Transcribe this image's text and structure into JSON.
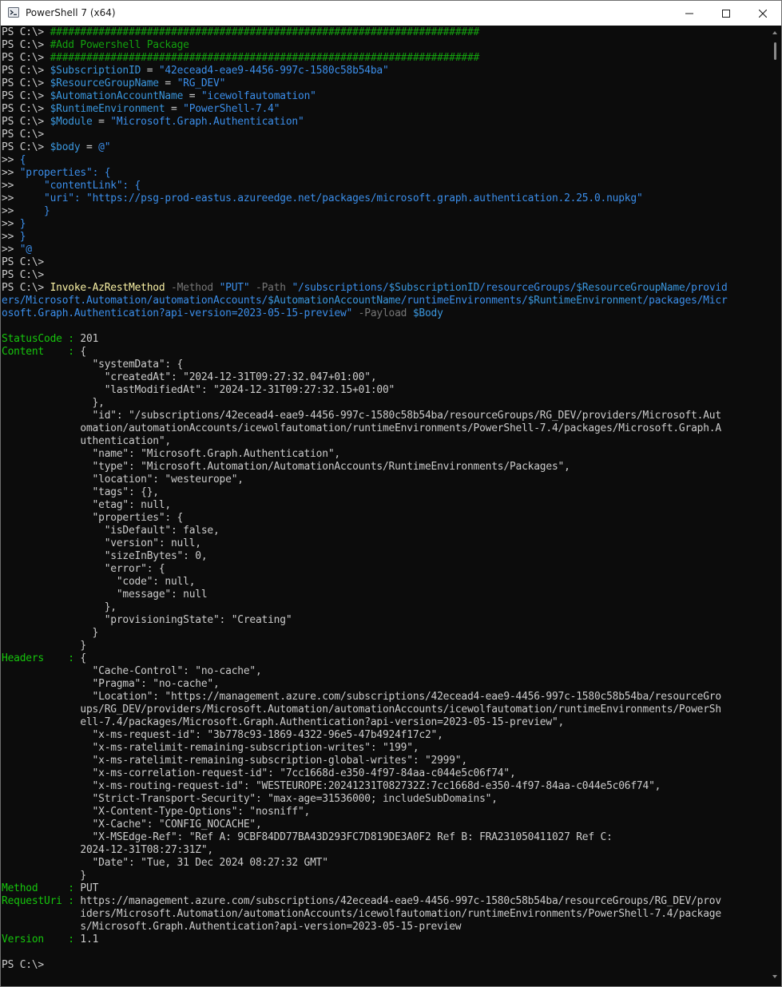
{
  "window": {
    "title": "PowerShell 7 (x64)",
    "icon": "powershell-icon",
    "controls": {
      "minimize": "minimize-icon",
      "maximize": "maximize-icon",
      "close": "close-icon"
    }
  },
  "colors": {
    "background": "#0c0c0c",
    "default_text": "#cccccc",
    "comment": "#13a10e",
    "variable": "#3a96dd",
    "string": "#3b8eea",
    "command": "#f9f1a5",
    "parameter": "#767676",
    "property_name": "#16c60c"
  },
  "terminal": {
    "lines": [
      [
        {
          "t": "PS C:\\> ",
          "c": "default"
        },
        {
          "t": "#######################################################################",
          "c": "comment"
        }
      ],
      [
        {
          "t": "PS C:\\> ",
          "c": "default"
        },
        {
          "t": "#Add Powershell Package",
          "c": "comment"
        }
      ],
      [
        {
          "t": "PS C:\\> ",
          "c": "default"
        },
        {
          "t": "#######################################################################",
          "c": "comment"
        }
      ],
      [
        {
          "t": "PS C:\\> ",
          "c": "default"
        },
        {
          "t": "$SubscriptionID",
          "c": "var"
        },
        {
          "t": " = ",
          "c": "op"
        },
        {
          "t": "\"42ecead4-eae9-4456-997c-1580c58b54ba\"",
          "c": "string"
        }
      ],
      [
        {
          "t": "PS C:\\> ",
          "c": "default"
        },
        {
          "t": "$ResourceGroupName",
          "c": "var"
        },
        {
          "t": " = ",
          "c": "op"
        },
        {
          "t": "\"RG_DEV\"",
          "c": "string"
        }
      ],
      [
        {
          "t": "PS C:\\> ",
          "c": "default"
        },
        {
          "t": "$AutomationAccountName",
          "c": "var"
        },
        {
          "t": " = ",
          "c": "op"
        },
        {
          "t": "\"icewolfautomation\"",
          "c": "string"
        }
      ],
      [
        {
          "t": "PS C:\\> ",
          "c": "default"
        },
        {
          "t": "$RuntimeEnvironment",
          "c": "var"
        },
        {
          "t": " = ",
          "c": "op"
        },
        {
          "t": "\"PowerShell-7.4\"",
          "c": "string"
        }
      ],
      [
        {
          "t": "PS C:\\> ",
          "c": "default"
        },
        {
          "t": "$Module",
          "c": "var"
        },
        {
          "t": " = ",
          "c": "op"
        },
        {
          "t": "\"Microsoft.Graph.Authentication\"",
          "c": "string"
        }
      ],
      [
        {
          "t": "PS C:\\>",
          "c": "default"
        }
      ],
      [
        {
          "t": "PS C:\\> ",
          "c": "default"
        },
        {
          "t": "$body",
          "c": "var"
        },
        {
          "t": " = ",
          "c": "op"
        },
        {
          "t": "@\"",
          "c": "string"
        }
      ],
      [
        {
          "t": ">> ",
          "c": "default"
        },
        {
          "t": "{",
          "c": "brace"
        }
      ],
      [
        {
          "t": ">> ",
          "c": "default"
        },
        {
          "t": "\"properties\": {",
          "c": "brace"
        }
      ],
      [
        {
          "t": ">>     ",
          "c": "default"
        },
        {
          "t": "\"contentLink\": {",
          "c": "brace"
        }
      ],
      [
        {
          "t": ">>     ",
          "c": "default"
        },
        {
          "t": "\"uri\": \"https://psg-prod-eastus.azureedge.net/packages/microsoft.graph.authentication.2.25.0.nupkg\"",
          "c": "brace"
        }
      ],
      [
        {
          "t": ">>     ",
          "c": "default"
        },
        {
          "t": "}",
          "c": "brace"
        }
      ],
      [
        {
          "t": ">> ",
          "c": "default"
        },
        {
          "t": "}",
          "c": "brace"
        }
      ],
      [
        {
          "t": ">> ",
          "c": "default"
        },
        {
          "t": "}",
          "c": "brace"
        }
      ],
      [
        {
          "t": ">> ",
          "c": "default"
        },
        {
          "t": "\"@",
          "c": "brace"
        }
      ],
      [
        {
          "t": "PS C:\\>",
          "c": "default"
        }
      ],
      [
        {
          "t": "PS C:\\>",
          "c": "default"
        }
      ],
      [
        {
          "t": "PS C:\\> ",
          "c": "default"
        },
        {
          "t": "Invoke-AzRestMethod",
          "c": "cmd"
        },
        {
          "t": " -Method ",
          "c": "param"
        },
        {
          "t": "\"PUT\"",
          "c": "string"
        },
        {
          "t": " -Path ",
          "c": "param"
        },
        {
          "t": "\"/subscriptions/",
          "c": "string"
        },
        {
          "t": "$SubscriptionID",
          "c": "var"
        },
        {
          "t": "/resourceGroups/",
          "c": "string"
        },
        {
          "t": "$ResourceGroupName",
          "c": "var"
        },
        {
          "t": "/provid",
          "c": "string"
        }
      ],
      [
        {
          "t": "ers/Microsoft.Automation/automationAccounts/",
          "c": "string"
        },
        {
          "t": "$AutomationAccountName",
          "c": "var"
        },
        {
          "t": "/runtimeEnvironments/",
          "c": "string"
        },
        {
          "t": "$RuntimeEnvironment",
          "c": "var"
        },
        {
          "t": "/packages/Micr",
          "c": "string"
        }
      ],
      [
        {
          "t": "osoft.Graph.Authentication?api-version=2023-05-15-preview\"",
          "c": "string"
        },
        {
          "t": " -Payload ",
          "c": "param"
        },
        {
          "t": "$Body",
          "c": "var"
        }
      ],
      [
        {
          "t": "",
          "c": "default"
        }
      ],
      [
        {
          "t": "StatusCode : ",
          "c": "key"
        },
        {
          "t": "201",
          "c": "default"
        }
      ],
      [
        {
          "t": "Content    : ",
          "c": "key"
        },
        {
          "t": "{",
          "c": "default"
        }
      ],
      [
        {
          "t": "               \"systemData\": {",
          "c": "default"
        }
      ],
      [
        {
          "t": "                 \"createdAt\": \"2024-12-31T09:27:32.047+01:00\",",
          "c": "default"
        }
      ],
      [
        {
          "t": "                 \"lastModifiedAt\": \"2024-12-31T09:27:32.15+01:00\"",
          "c": "default"
        }
      ],
      [
        {
          "t": "               },",
          "c": "default"
        }
      ],
      [
        {
          "t": "               \"id\": \"/subscriptions/42ecead4-eae9-4456-997c-1580c58b54ba/resourceGroups/RG_DEV/providers/Microsoft.Aut",
          "c": "default"
        }
      ],
      [
        {
          "t": "             omation/automationAccounts/icewolfautomation/runtimeEnvironments/PowerShell-7.4/packages/Microsoft.Graph.A",
          "c": "default"
        }
      ],
      [
        {
          "t": "             uthentication\",",
          "c": "default"
        }
      ],
      [
        {
          "t": "               \"name\": \"Microsoft.Graph.Authentication\",",
          "c": "default"
        }
      ],
      [
        {
          "t": "               \"type\": \"Microsoft.Automation/AutomationAccounts/RuntimeEnvironments/Packages\",",
          "c": "default"
        }
      ],
      [
        {
          "t": "               \"location\": \"westeurope\",",
          "c": "default"
        }
      ],
      [
        {
          "t": "               \"tags\": {},",
          "c": "default"
        }
      ],
      [
        {
          "t": "               \"etag\": null,",
          "c": "default"
        }
      ],
      [
        {
          "t": "               \"properties\": {",
          "c": "default"
        }
      ],
      [
        {
          "t": "                 \"isDefault\": false,",
          "c": "default"
        }
      ],
      [
        {
          "t": "                 \"version\": null,",
          "c": "default"
        }
      ],
      [
        {
          "t": "                 \"sizeInBytes\": 0,",
          "c": "default"
        }
      ],
      [
        {
          "t": "                 \"error\": {",
          "c": "default"
        }
      ],
      [
        {
          "t": "                   \"code\": null,",
          "c": "default"
        }
      ],
      [
        {
          "t": "                   \"message\": null",
          "c": "default"
        }
      ],
      [
        {
          "t": "                 },",
          "c": "default"
        }
      ],
      [
        {
          "t": "                 \"provisioningState\": \"Creating\"",
          "c": "default"
        }
      ],
      [
        {
          "t": "               }",
          "c": "default"
        }
      ],
      [
        {
          "t": "             }",
          "c": "default"
        }
      ],
      [
        {
          "t": "Headers    : ",
          "c": "key"
        },
        {
          "t": "{",
          "c": "default"
        }
      ],
      [
        {
          "t": "               \"Cache-Control\": \"no-cache\",",
          "c": "default"
        }
      ],
      [
        {
          "t": "               \"Pragma\": \"no-cache\",",
          "c": "default"
        }
      ],
      [
        {
          "t": "               \"Location\": \"https://management.azure.com/subscriptions/42ecead4-eae9-4456-997c-1580c58b54ba/resourceGro",
          "c": "default"
        }
      ],
      [
        {
          "t": "             ups/RG_DEV/providers/Microsoft.Automation/automationAccounts/icewolfautomation/runtimeEnvironments/PowerSh",
          "c": "default"
        }
      ],
      [
        {
          "t": "             ell-7.4/packages/Microsoft.Graph.Authentication?api-version=2023-05-15-preview\",",
          "c": "default"
        }
      ],
      [
        {
          "t": "               \"x-ms-request-id\": \"3b778c93-1869-4322-96e5-47b4924f17c2\",",
          "c": "default"
        }
      ],
      [
        {
          "t": "               \"x-ms-ratelimit-remaining-subscription-writes\": \"199\",",
          "c": "default"
        }
      ],
      [
        {
          "t": "               \"x-ms-ratelimit-remaining-subscription-global-writes\": \"2999\",",
          "c": "default"
        }
      ],
      [
        {
          "t": "               \"x-ms-correlation-request-id\": \"7cc1668d-e350-4f97-84aa-c044e5c06f74\",",
          "c": "default"
        }
      ],
      [
        {
          "t": "               \"x-ms-routing-request-id\": \"WESTEUROPE:20241231T082732Z:7cc1668d-e350-4f97-84aa-c044e5c06f74\",",
          "c": "default"
        }
      ],
      [
        {
          "t": "               \"Strict-Transport-Security\": \"max-age=31536000; includeSubDomains\",",
          "c": "default"
        }
      ],
      [
        {
          "t": "               \"X-Content-Type-Options\": \"nosniff\",",
          "c": "default"
        }
      ],
      [
        {
          "t": "               \"X-Cache\": \"CONFIG_NOCACHE\",",
          "c": "default"
        }
      ],
      [
        {
          "t": "               \"X-MSEdge-Ref\": \"Ref A: 9CBF84DD77BA43D293FC7D819DE3A0F2 Ref B: FRA231050411027 Ref C:",
          "c": "default"
        }
      ],
      [
        {
          "t": "             2024-12-31T08:27:31Z\",",
          "c": "default"
        }
      ],
      [
        {
          "t": "               \"Date\": \"Tue, 31 Dec 2024 08:27:32 GMT\"",
          "c": "default"
        }
      ],
      [
        {
          "t": "             }",
          "c": "default"
        }
      ],
      [
        {
          "t": "Method     : ",
          "c": "key"
        },
        {
          "t": "PUT",
          "c": "default"
        }
      ],
      [
        {
          "t": "RequestUri : ",
          "c": "key"
        },
        {
          "t": "https://management.azure.com/subscriptions/42ecead4-eae9-4456-997c-1580c58b54ba/resourceGroups/RG_DEV/prov",
          "c": "default"
        }
      ],
      [
        {
          "t": "             iders/Microsoft.Automation/automationAccounts/icewolfautomation/runtimeEnvironments/PowerShell-7.4/package",
          "c": "default"
        }
      ],
      [
        {
          "t": "             s/Microsoft.Graph.Authentication?api-version=2023-05-15-preview",
          "c": "default"
        }
      ],
      [
        {
          "t": "Version    : ",
          "c": "key"
        },
        {
          "t": "1.1",
          "c": "default"
        }
      ],
      [
        {
          "t": "",
          "c": "default"
        }
      ],
      [
        {
          "t": "PS C:\\>",
          "c": "default"
        }
      ]
    ]
  }
}
